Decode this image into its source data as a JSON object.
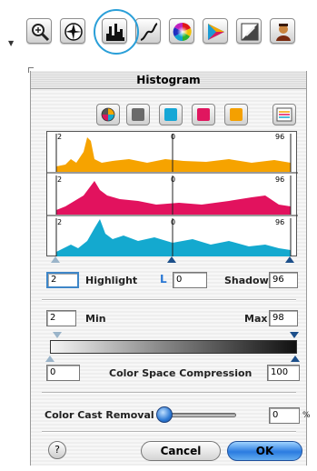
{
  "toolbar": {
    "tools": [
      {
        "name": "zoom-tool",
        "icon": "magnifier-icon"
      },
      {
        "name": "aperture-tool",
        "icon": "aperture-icon"
      },
      {
        "name": "histogram-tool",
        "icon": "histogram-icon"
      },
      {
        "name": "curves-tool",
        "icon": "curves-icon"
      },
      {
        "name": "color-wheel-tool",
        "icon": "color-wheel-icon"
      },
      {
        "name": "saturation-tool",
        "icon": "saturation-icon"
      },
      {
        "name": "picker-tool",
        "icon": "eyedropper-icon"
      },
      {
        "name": "portrait-tool",
        "icon": "portrait-icon"
      }
    ],
    "active": "histogram-tool",
    "highlight_color": "#2a9fd8"
  },
  "dialog": {
    "title": "Histogram",
    "channels": [
      {
        "name": "channel-all",
        "color": "multicolor"
      },
      {
        "name": "channel-black",
        "color": "#6b6b6b"
      },
      {
        "name": "channel-cyan",
        "color": "#16a7d6"
      },
      {
        "name": "channel-magenta",
        "color": "#e0165f"
      },
      {
        "name": "channel-yellow",
        "color": "#f4a000"
      }
    ],
    "histograms": [
      {
        "channel": "yellow",
        "color": "#f6a300",
        "left_label": "2",
        "mid_label": "0",
        "right_label": "96"
      },
      {
        "channel": "magenta",
        "color": "#e2125e",
        "left_label": "2",
        "mid_label": "0",
        "right_label": "96"
      },
      {
        "channel": "cyan",
        "color": "#14a9cf",
        "left_label": "2",
        "mid_label": "0",
        "right_label": "96"
      }
    ],
    "highlight": {
      "value": "2",
      "label": "Highlight"
    },
    "midtone": {
      "value": "0",
      "label": "L"
    },
    "shadow": {
      "value": "96",
      "label": "Shadow"
    },
    "min": {
      "value": "2",
      "label": "Min"
    },
    "max": {
      "value": "98",
      "label": "Max"
    },
    "compression": {
      "left_value": "0",
      "label": "Color Space Compression",
      "right_value": "100"
    },
    "cast_removal": {
      "label": "Color Cast Removal",
      "value": "0",
      "unit": "%",
      "slider_level": 0
    },
    "buttons": {
      "cancel": "Cancel",
      "ok": "OK",
      "help": "?"
    }
  }
}
